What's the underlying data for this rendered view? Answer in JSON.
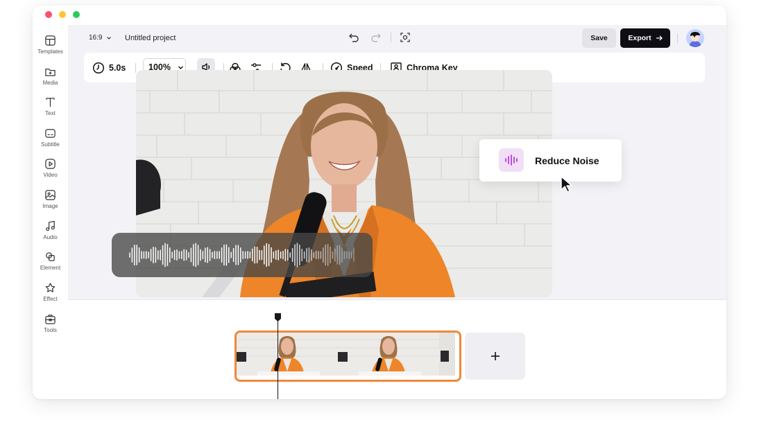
{
  "window": {
    "controls": [
      "close",
      "minimize",
      "maximize"
    ],
    "dot_colors": [
      "#ff4d72",
      "#ffc52e",
      "#2dc95e"
    ]
  },
  "sidebar": {
    "items": [
      {
        "label": "Templates",
        "icon": "templates-icon"
      },
      {
        "label": "Media",
        "icon": "media-icon"
      },
      {
        "label": "Text",
        "icon": "text-icon"
      },
      {
        "label": "Subtitle",
        "icon": "subtitle-icon"
      },
      {
        "label": "Video",
        "icon": "video-icon"
      },
      {
        "label": "Image",
        "icon": "image-icon"
      },
      {
        "label": "Audio",
        "icon": "audio-icon"
      },
      {
        "label": "Element",
        "icon": "element-icon"
      },
      {
        "label": "Effect",
        "icon": "effect-icon"
      },
      {
        "label": "Tools",
        "icon": "tools-icon"
      }
    ]
  },
  "header": {
    "aspect_ratio": "16:9",
    "project_title": "Untitled project",
    "save_label": "Save",
    "export_label": "Export"
  },
  "toolbar": {
    "duration": "5.0s",
    "zoom": "100%",
    "speed_label": "Speed",
    "chroma_label": "Chroma Key"
  },
  "popup": {
    "label": "Reduce Noise",
    "accent": "#b53ee0"
  },
  "colors": {
    "accent_orange": "#f0883a",
    "export_bg": "#0e0e14",
    "canvas_bg": "#f3f3f7"
  }
}
